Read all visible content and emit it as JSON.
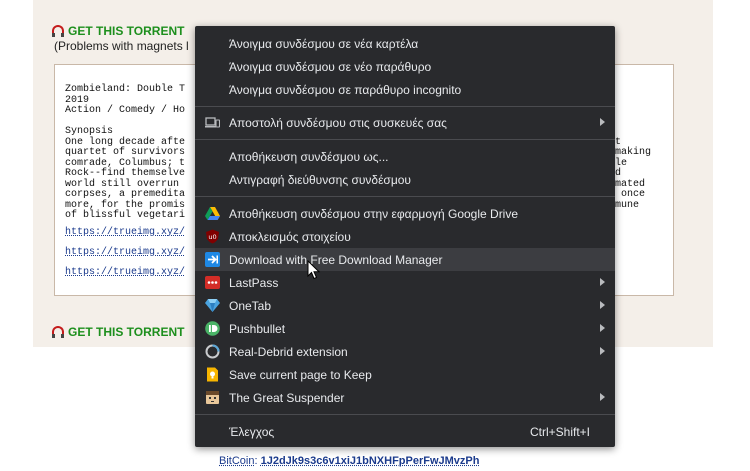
{
  "page": {
    "torrent_link_1": "GET THIS TORRENT",
    "torrent_link_2": "GET THIS TORRENT",
    "problems_text": "(Problems with magnets l",
    "description": {
      "lines": [
        "Zombieland: Double T",
        "2019",
        "Action / Comedy / Ho",
        "",
        "Synopsis",
        "One long decade afte",
        "quartet of survivors",
        "comrade, Columbus; t",
        "Rock--find themselve",
        "world still overrun ",
        "corpses, a premedita",
        "more, for the promis",
        "of blissful vegetari"
      ],
      "right_fragments": [
        "t",
        "making",
        "le",
        "d",
        "mated",
        " once",
        "mune"
      ],
      "image_links": [
        "https://trueimg.xyz/",
        "https://trueimg.xyz/",
        "https://trueimg.xyz/"
      ]
    },
    "bitcoin_label": "BitCoin",
    "bitcoin_separator": ": ",
    "bitcoin_address": "1J2dJk9s3c6v1xiJ1bNXHFpPerFwJMvzPh"
  },
  "context_menu": {
    "items": [
      {
        "label": "Άνοιγμα συνδέσμου σε νέα καρτέλα"
      },
      {
        "label": "Άνοιγμα συνδέσμου σε νέο παράθυρο"
      },
      {
        "label": "Άνοιγμα συνδέσμου σε παράθυρο incognito"
      },
      {
        "label": "Αποστολή συνδέσμου στις συσκευές σας",
        "icon": "laptop-phone-icon"
      },
      {
        "label": "Αποθήκευση συνδέσμου ως..."
      },
      {
        "label": "Αντιγραφή διεύθυνσης συνδέσμου"
      },
      {
        "label": "Αποθήκευση συνδέσμου στην εφαρμογή Google Drive",
        "icon": "google-drive-icon"
      },
      {
        "label": "Αποκλεισμός στοιχείου",
        "icon": "ublock-icon"
      },
      {
        "label": "Download with Free Download Manager",
        "icon": "fdm-icon"
      },
      {
        "label": "LastPass",
        "icon": "lastpass-icon"
      },
      {
        "label": "OneTab",
        "icon": "onetab-icon"
      },
      {
        "label": "Pushbullet",
        "icon": "pushbullet-icon"
      },
      {
        "label": "Real-Debrid extension",
        "icon": "real-debrid-icon"
      },
      {
        "label": "Save current page to Keep",
        "icon": "keep-icon"
      },
      {
        "label": "The Great Suspender",
        "icon": "great-suspender-icon"
      },
      {
        "label": "Έλεγχος",
        "shortcut": "Ctrl+Shift+I"
      }
    ]
  },
  "colors": {
    "menu_bg": "#292a2d",
    "menu_highlight": "#3c3d41",
    "menu_text": "#e8eaed",
    "torrent_green": "#1d8f1d",
    "link_blue": "#1a3a8c",
    "panel_beige": "#f4efe9"
  }
}
